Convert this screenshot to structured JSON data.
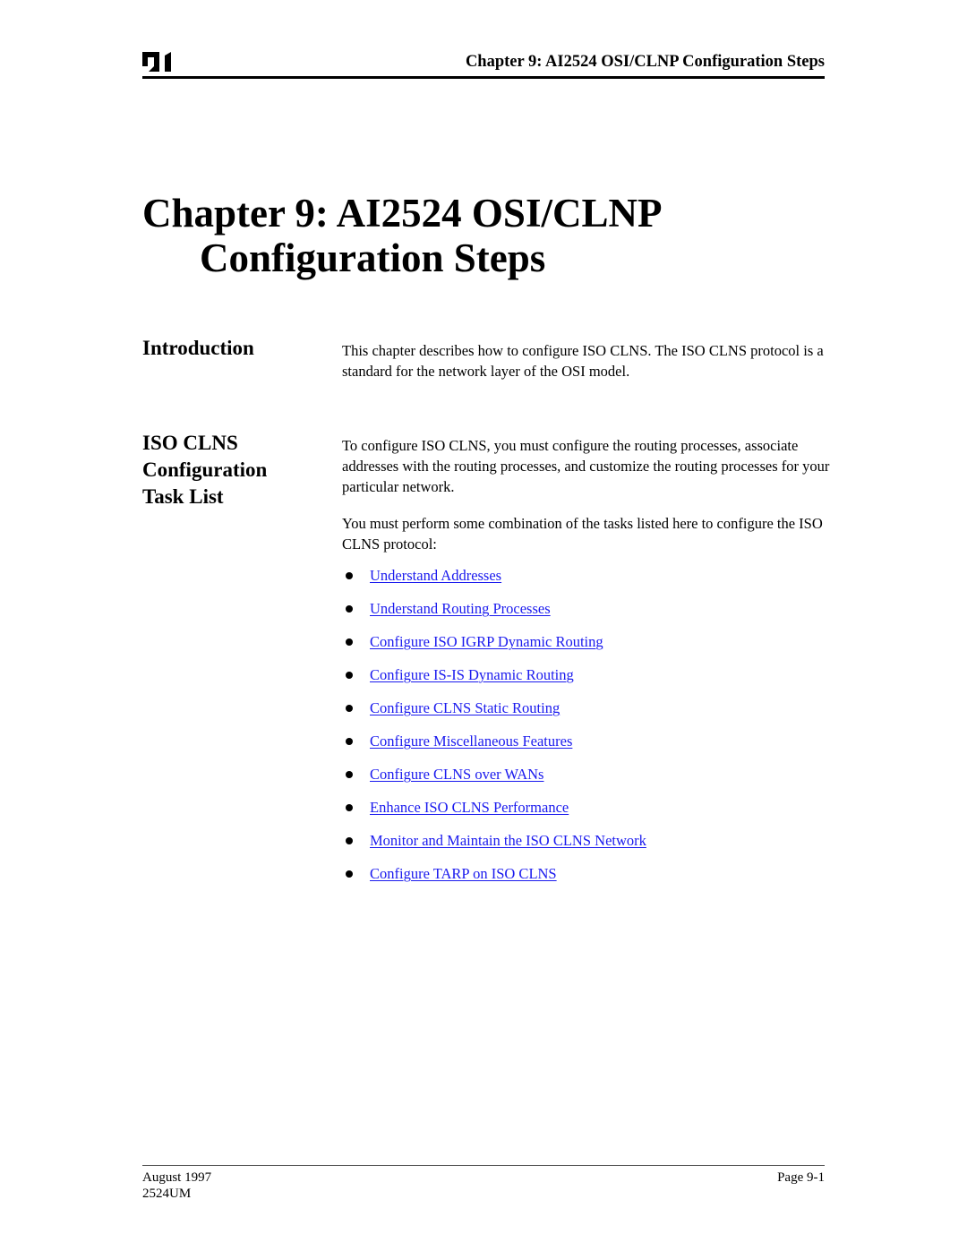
{
  "header": {
    "logo": "company-logo",
    "running_title": "Chapter 9: AI2524 OSI/CLNP Configuration Steps"
  },
  "chapter": {
    "title_line1": "Chapter 9: AI2524 OSI/CLNP",
    "title_line2": "Configuration Steps"
  },
  "introduction": {
    "heading": "Introduction",
    "text": "This chapter describes how to configure ISO CLNS.  The ISO CLNS protocol is a standard for the network layer of the OSI model."
  },
  "task_list_section": {
    "heading_line1": "ISO CLNS",
    "heading_line2": "Configuration",
    "heading_line3": "Task List",
    "paragraph1": "To configure ISO CLNS, you must configure the routing processes, associate addresses with the routing processes, and customize the routing processes for your particular network.",
    "paragraph2": "You must perform some combination of the tasks listed here to configure the ISO CLNS protocol:",
    "bullet_icon": "bullet-dot",
    "link_color": "#1a1aee",
    "tasks": [
      {
        "label": "Understand Addresses"
      },
      {
        "label": "Understand Routing Processes"
      },
      {
        "label": "Configure ISO IGRP Dynamic Routing"
      },
      {
        "label": "Configure IS-IS Dynamic Routing"
      },
      {
        "label": "Configure CLNS Static Routing"
      },
      {
        "label": "Configure Miscellaneous Features"
      },
      {
        "label": "Configure CLNS over WANs"
      },
      {
        "label": "Enhance ISO CLNS Performance"
      },
      {
        "label": "Monitor and Maintain the ISO CLNS Network"
      },
      {
        "label": "Configure TARP on ISO CLNS"
      }
    ]
  },
  "footer": {
    "date": "August 1997",
    "doc_id": "2524UM",
    "page": "Page 9-1"
  }
}
